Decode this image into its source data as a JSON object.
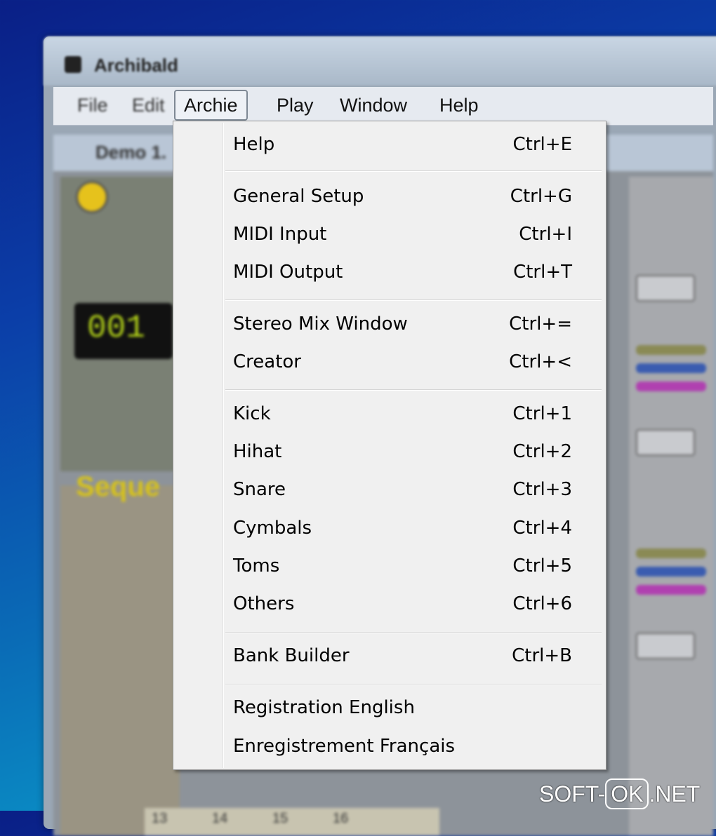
{
  "app": {
    "title": "Archibald",
    "document_title": "Demo 1."
  },
  "menubar": {
    "items": [
      {
        "label": "File"
      },
      {
        "label": "Edit"
      },
      {
        "label": "Archie"
      },
      {
        "label": "Play"
      },
      {
        "label": "Window"
      },
      {
        "label": "Help"
      }
    ]
  },
  "archie_menu": {
    "items": [
      {
        "label": "Help",
        "shortcut": "Ctrl+E"
      },
      {
        "label": "General Setup",
        "shortcut": "Ctrl+G"
      },
      {
        "label": "MIDI Input",
        "shortcut": "Ctrl+I"
      },
      {
        "label": "MIDI Output",
        "shortcut": "Ctrl+T"
      },
      {
        "label": "Stereo Mix Window",
        "shortcut": "Ctrl+="
      },
      {
        "label": "Creator",
        "shortcut": "Ctrl+<"
      },
      {
        "label": "Kick",
        "shortcut": "Ctrl+1"
      },
      {
        "label": "Hihat",
        "shortcut": "Ctrl+2"
      },
      {
        "label": "Snare",
        "shortcut": "Ctrl+3"
      },
      {
        "label": "Cymbals",
        "shortcut": "Ctrl+4"
      },
      {
        "label": "Toms",
        "shortcut": "Ctrl+5"
      },
      {
        "label": "Others",
        "shortcut": "Ctrl+6"
      },
      {
        "label": "Bank Builder",
        "shortcut": "Ctrl+B"
      },
      {
        "label": "Registration English",
        "shortcut": ""
      },
      {
        "label": "Enregistrement Français",
        "shortcut": ""
      }
    ]
  },
  "background": {
    "counter": "001",
    "section_label": "Seque",
    "step_numbers": [
      "13",
      "14",
      "15",
      "16"
    ]
  },
  "watermark": {
    "prefix": "SOFT-",
    "boxed": "OK",
    "suffix": ".NET"
  }
}
